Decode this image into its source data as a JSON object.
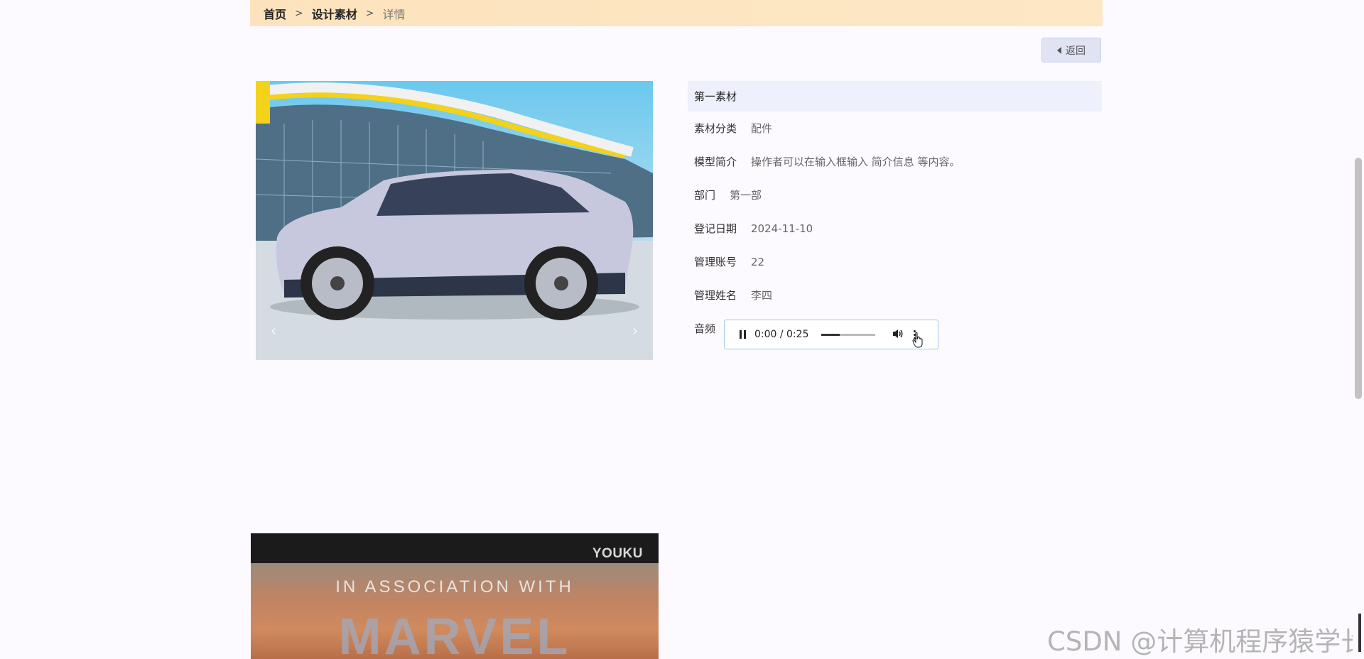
{
  "breadcrumb": {
    "home": "首页",
    "section": "设计素材",
    "current": "详情",
    "separator": ">"
  },
  "back_button": {
    "label": "返回",
    "icon": "caret-left-icon"
  },
  "info": {
    "title": "第一素材",
    "rows": [
      {
        "label": "素材分类",
        "value": "配件"
      },
      {
        "label": "模型简介",
        "value": "操作者可以在输入框输入 简介信息 等内容。"
      },
      {
        "label": "部门",
        "value": "第一部"
      },
      {
        "label": "登记日期",
        "value": "2024-11-10"
      },
      {
        "label": "管理账号",
        "value": "22"
      },
      {
        "label": "管理姓名",
        "value": "李四"
      },
      {
        "label": "音频",
        "value": ""
      }
    ]
  },
  "audio": {
    "time": "0:00 / 0:25",
    "progress_fraction": 0.35,
    "icons": [
      "pause-icon",
      "volume-icon",
      "more-options-icon"
    ]
  },
  "video": {
    "logo": "YOUKU",
    "caption": "IN ASSOCIATION WITH",
    "big_text": "MARVEL"
  },
  "watermark": "CSDN @计算机程序猿学长",
  "colors": {
    "breadcrumb_bg": "#fde5c1",
    "info_title_bg": "#eef0fb",
    "back_button_bg": "#dfe3f3",
    "page_bg": "#fcfaff"
  }
}
